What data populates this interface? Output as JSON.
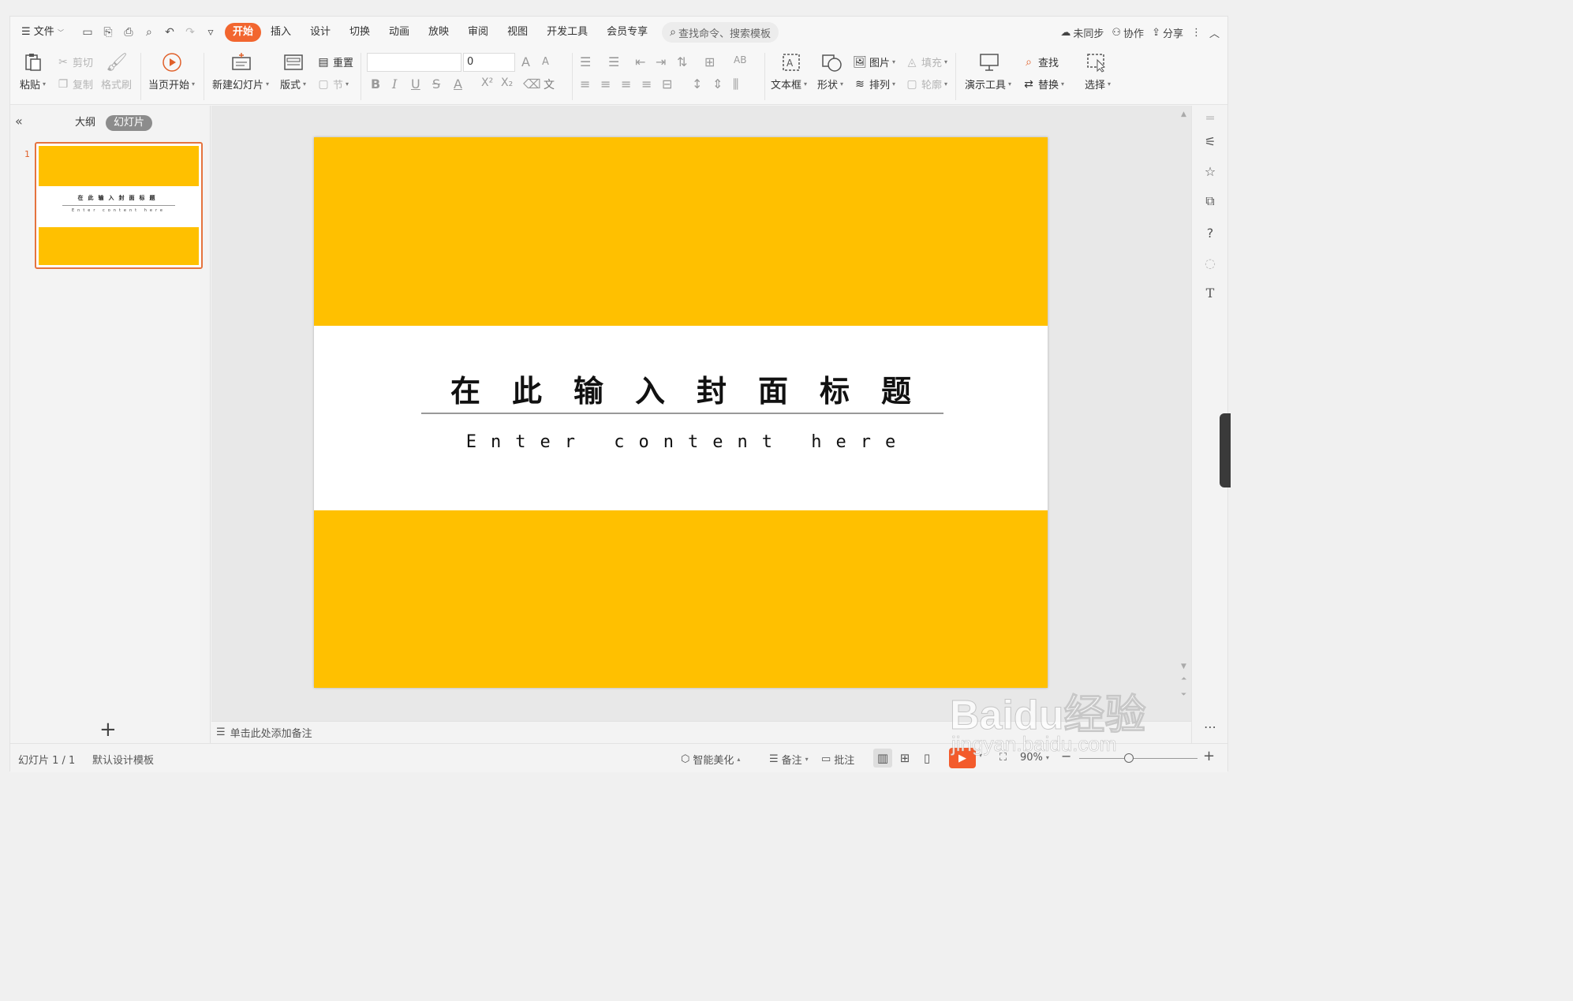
{
  "menubar": {
    "file_label": "文件",
    "tabs": [
      "开始",
      "插入",
      "设计",
      "切换",
      "动画",
      "放映",
      "审阅",
      "视图",
      "开发工具",
      "会员专享"
    ],
    "active_tab": "开始",
    "search_placeholder": "查找命令、搜索模板",
    "sync_label": "未同步",
    "collab_label": "协作",
    "share_label": "分享"
  },
  "ribbon": {
    "paste": "粘贴",
    "cut": "剪切",
    "copy": "复制",
    "format_painter": "格式刷",
    "from_current": "当页开始",
    "new_slide": "新建幻灯片",
    "layout": "版式",
    "reset": "重置",
    "section": "节",
    "font_size": "0",
    "textbox": "文本框",
    "shape": "形状",
    "picture": "图片",
    "fill": "填充",
    "arrange": "排列",
    "outline": "轮廓",
    "presenter_tools": "演示工具",
    "find": "查找",
    "replace": "替换",
    "select": "选择"
  },
  "left_panel": {
    "tab_outline": "大纲",
    "tab_slides": "幻灯片",
    "slide_number": "1"
  },
  "slide": {
    "title": "在此输入封面标题",
    "subtitle": "Enter content here",
    "colors": {
      "band": "#ffc000",
      "center": "#ffffff"
    }
  },
  "notes": {
    "placeholder": "单击此处添加备注"
  },
  "status": {
    "slide_counter": "幻灯片 1 / 1",
    "template": "默认设计模板",
    "smart_beautify": "智能美化",
    "notes_label": "备注",
    "comment_label": "批注",
    "zoom": "90%"
  },
  "watermark": {
    "brand": "Baidu经验",
    "url": "jingyan.baidu.com"
  }
}
